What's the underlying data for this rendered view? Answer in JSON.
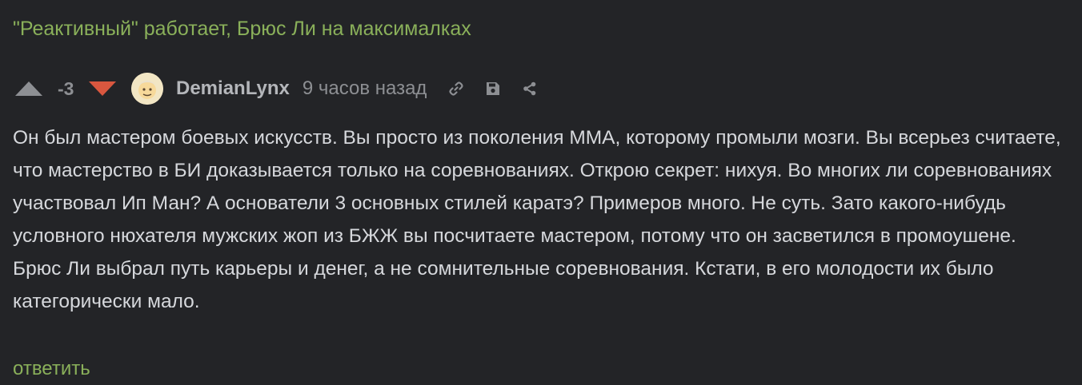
{
  "story": {
    "title": "\"Реактивный\" работает, Брюс Ли на максималках"
  },
  "comment": {
    "rating": "-3",
    "author": "DemianLynx",
    "time": "9 часов назад",
    "text": "Он был мастером боевых искусств. Вы просто из поколения ММА, которому промыли мозги. Вы всерьез считаете, что мастерство в БИ доказывается только на соревнованиях. Открою секрет: нихуя. Во многих ли соревнованиях участвовал Ип Ман? А основатели 3 основных стилей каратэ? Примеров много. Не суть. Зато какого-нибудь условного нюхателя мужских жоп из БЖЖ вы посчитаете мастером, потому что он засветился в промоушене. Брюс Ли выбрал путь карьеры и денег, а не сомнительные соревнования. Кстати, в его молодости их было категорически мало.",
    "reply_label": "ответить"
  },
  "icons": {
    "vote_up": "arrow-up-triangle",
    "vote_down": "arrow-down-triangle",
    "link": "chain-link-icon",
    "save": "floppy-disk-icon",
    "share": "share-icon"
  },
  "colors": {
    "background": "#232427",
    "accent_green": "#8ab05a",
    "vote_down_red": "#d9573f",
    "vote_up_gray": "#8d8f93",
    "text": "#d6d8dc"
  }
}
